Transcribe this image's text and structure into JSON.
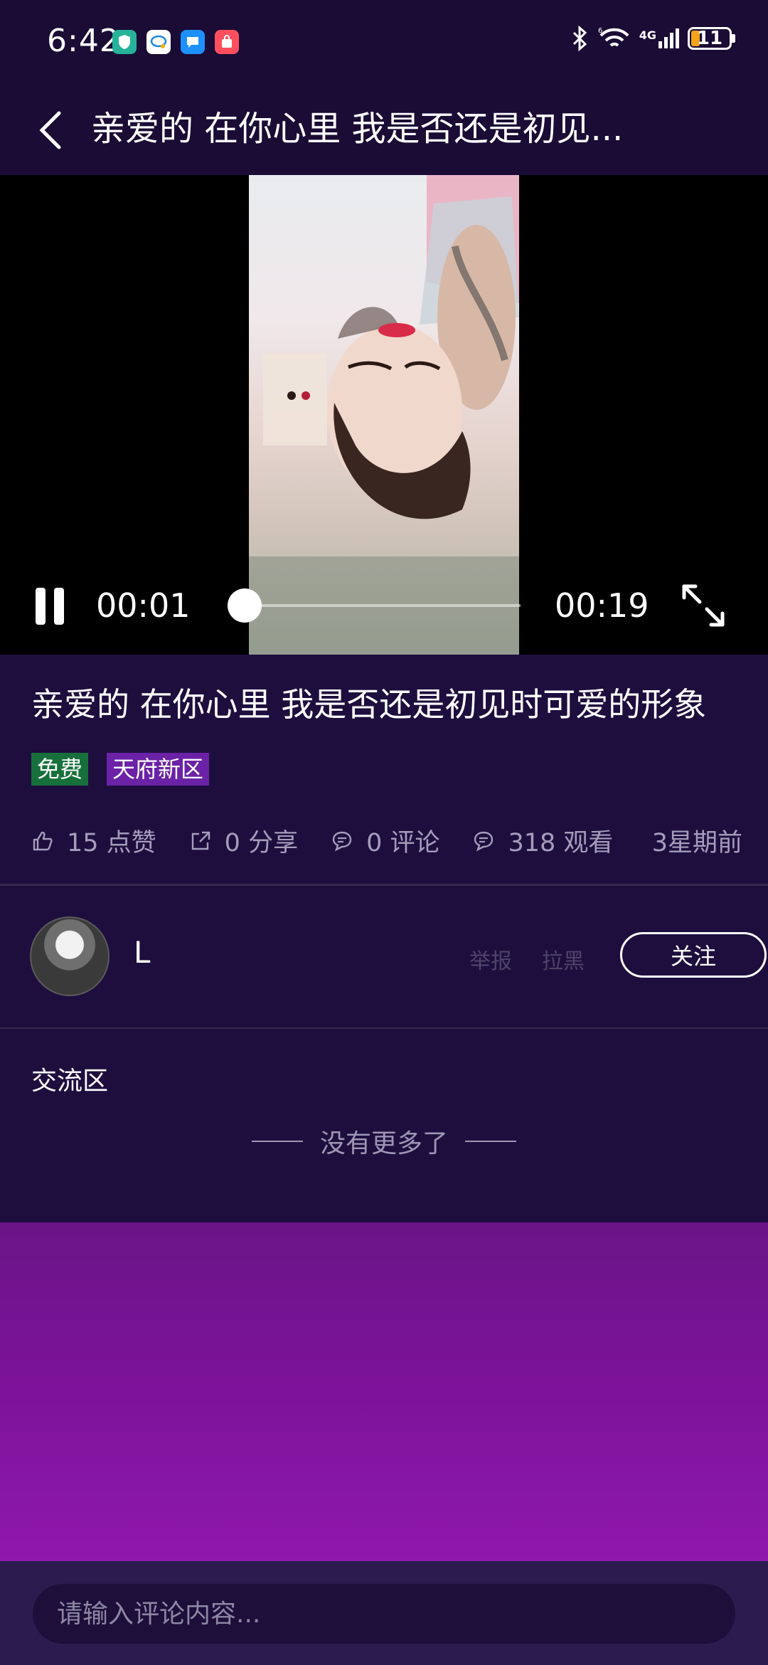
{
  "status_bar": {
    "time": "6:42",
    "network": "4G",
    "battery": "11",
    "app_icons": [
      "app-shield-icon",
      "app-chat-icon",
      "app-message-icon",
      "app-shop-icon"
    ]
  },
  "header": {
    "title": "亲爱的 在你心里 我是否还是初见..."
  },
  "video": {
    "current_time": "00:01",
    "total_time": "00:19",
    "progress": 0.05
  },
  "info": {
    "title": "亲爱的 在你心里 我是否还是初见时可爱的形象",
    "tags": [
      "免费",
      "天府新区"
    ],
    "stats": {
      "likes": "15 点赞",
      "shares": "0 分享",
      "comments": "0 评论",
      "views": "318 观看",
      "time": "3星期前"
    }
  },
  "author": {
    "name": "L",
    "report_label": "举报",
    "block_label": "拉黑",
    "follow_label": "关注"
  },
  "comments": {
    "title": "交流区",
    "no_more": "没有更多了"
  },
  "comment_input": {
    "placeholder": "请输入评论内容..."
  },
  "colors": {
    "background": "#1a0c35",
    "panel": "#1e0e3e",
    "tag_free": "#17703b",
    "tag_region": "#6b22a6",
    "gradient_top": "#6a1487",
    "gradient_bottom": "#8f18ad"
  }
}
